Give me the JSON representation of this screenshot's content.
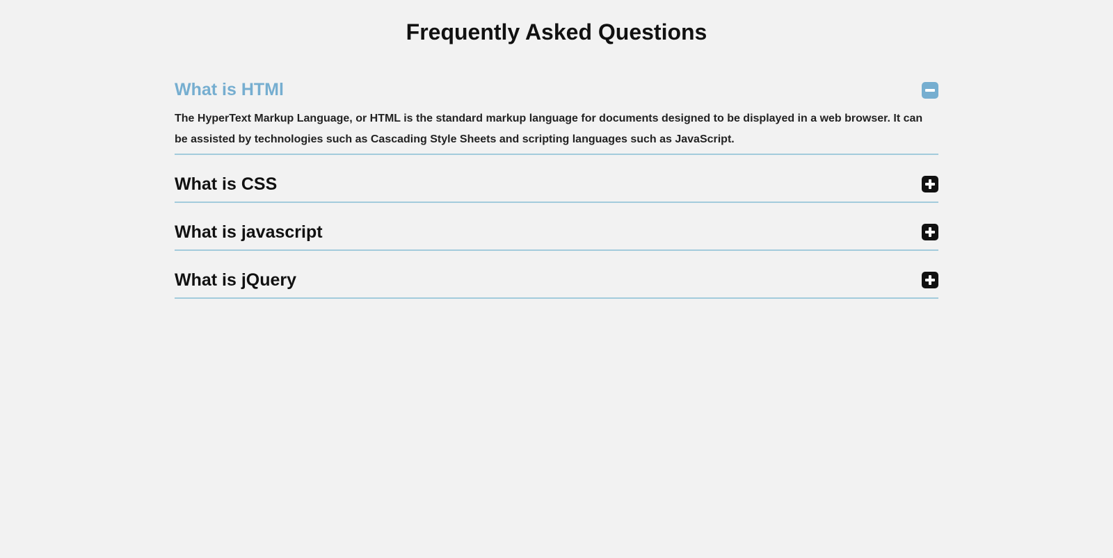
{
  "title": "Frequently Asked Questions",
  "faqs": [
    {
      "question": "What is HTMl",
      "answer": "The HyperText Markup Language, or HTML is the standard markup language for documents designed to be displayed in a web browser. It can be assisted by technologies such as Cascading Style Sheets and scripting languages such as JavaScript.",
      "expanded": true
    },
    {
      "question": "What is CSS",
      "answer": "",
      "expanded": false
    },
    {
      "question": "What is javascript",
      "answer": "",
      "expanded": false
    },
    {
      "question": "What is jQuery",
      "answer": "",
      "expanded": false
    }
  ]
}
